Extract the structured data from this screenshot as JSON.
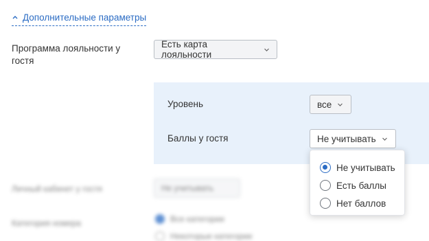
{
  "advanced": {
    "link_label": "Дополнительные параметры"
  },
  "loyalty": {
    "label": "Программа лояльности у гостя",
    "button_label": "Есть карта лояльности"
  },
  "panel": {
    "level_label": "Уровень",
    "level_value": "все",
    "points_label": "Баллы у гостя",
    "points_value": "Не учитывать"
  },
  "points_dropdown": {
    "options": [
      {
        "label": "Не учитывать",
        "selected": true
      },
      {
        "label": "Есть баллы",
        "selected": false
      },
      {
        "label": "Нет баллов",
        "selected": false
      }
    ]
  },
  "background": {
    "account_label": "Личный кабинет у гостя",
    "account_value": "Не учитывать",
    "room_category_label": "Категория номера",
    "room_option_all": "Все категории",
    "room_option_specific": "Некоторые категории"
  },
  "colors": {
    "accent": "#2b6cc4",
    "panel_bg": "#e8f1fb"
  }
}
